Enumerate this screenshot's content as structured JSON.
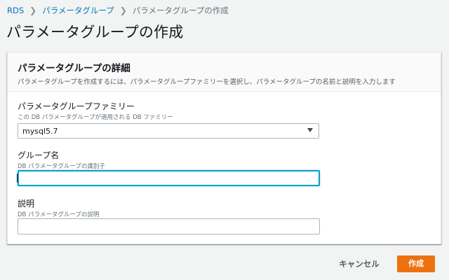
{
  "breadcrumb": {
    "items": [
      {
        "label": "RDS"
      },
      {
        "label": "パラメータグループ"
      },
      {
        "label": "パラメータグループの作成"
      }
    ]
  },
  "page_title": "パラメータグループの作成",
  "panel": {
    "title": "パラメータグループの詳細",
    "description": "パラメータグループを作成するには、パラメータグループファミリーを選択し、パラメータグループの名前と説明を入力します"
  },
  "fields": {
    "family": {
      "label": "パラメータグループファミリー",
      "hint": "この DB パラメータグループが適用される DB ファミリー",
      "value": "mysql5.7"
    },
    "group_name": {
      "label": "グループ名",
      "hint": "DB パラメータグループの識別子",
      "value": ""
    },
    "description": {
      "label": "説明",
      "hint": "DB パラメータグループの説明",
      "value": ""
    }
  },
  "actions": {
    "cancel_label": "キャンセル",
    "create_label": "作成"
  },
  "colors": {
    "link": "#0073bb",
    "primary": "#ec7211",
    "focus": "#00a1c9",
    "background": "#f2f3f3"
  }
}
